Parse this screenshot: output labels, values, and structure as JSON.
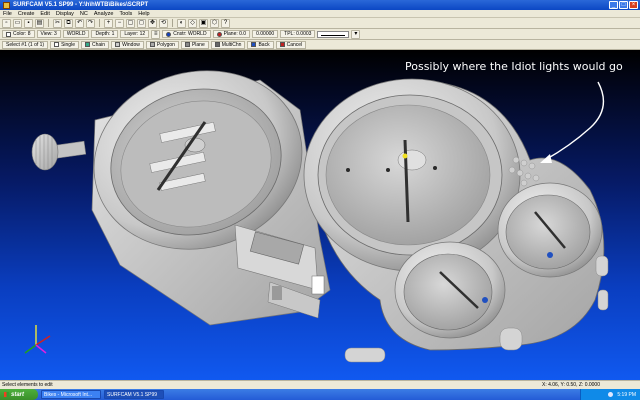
{
  "window": {
    "title": "SURFCAM V5.1 SP99 - Y:\\h\\hWTB\\Bikes\\SCRPT",
    "buttons": [
      "_",
      "□",
      "×"
    ]
  },
  "menubar": {
    "items": [
      "File",
      "Create",
      "Edit",
      "Display",
      "NC",
      "Analyze",
      "Tools",
      "Help"
    ]
  },
  "toolbar_row2": {
    "color_label": "Color: 8",
    "view_label": "View: 3",
    "mode_label": "WORLD",
    "depth_label": "Depth: 1",
    "layer_label": "Layer: 12",
    "construct_label": "Cnstr: WORLD",
    "plane_label": "Plane: 0.0",
    "units_label": "0.00000",
    "tol_label": "TPL: 0.0003"
  },
  "toolbar_row3": {
    "input_label": "Select #1 (1 of 1)",
    "items": [
      "Single",
      "Chain",
      "Window",
      "Polygon",
      "Plane",
      "MultiChn",
      "Back",
      "Cancel"
    ]
  },
  "viewport": {
    "annotation": "Possibly where the Idiot lights would go"
  },
  "status": {
    "message": "Select elements to edit",
    "coords": "X: 4.06, Y: 0.50, Z: 0.0000"
  },
  "taskbar": {
    "start_label": "start",
    "tasks": [
      "Bikes - Microsoft Int...",
      "SURFCAM V5.1 SP99"
    ],
    "clock": "5:19 PM"
  },
  "colors": {
    "viewport_bottom": "#1059f0",
    "part_gray": "#d4d4d4",
    "titlebar": "#0b47c4"
  }
}
